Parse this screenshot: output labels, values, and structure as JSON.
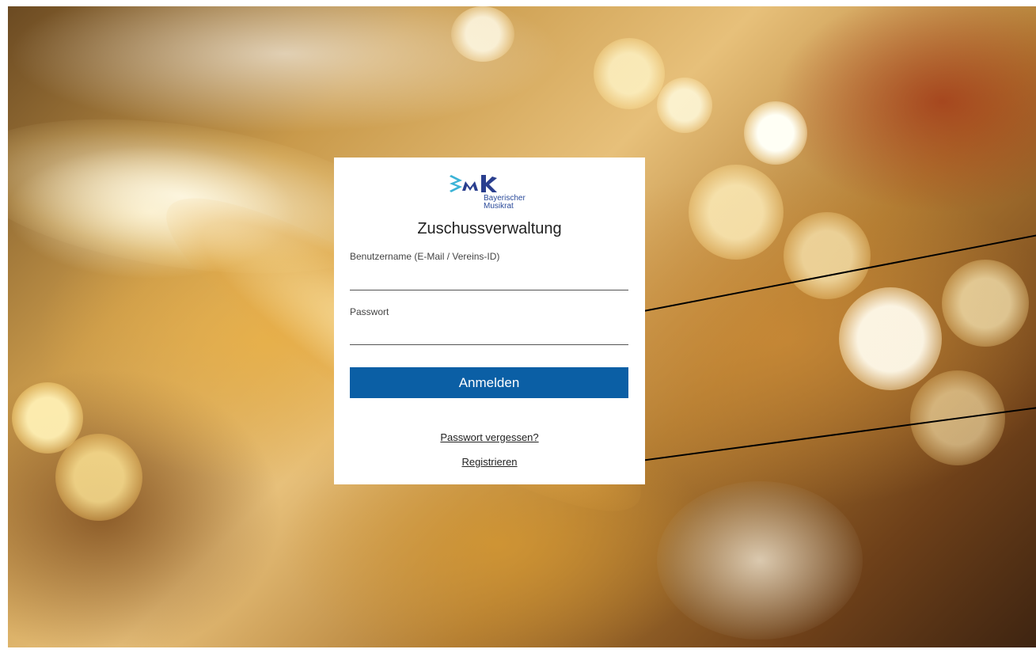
{
  "brand": {
    "logo_line1": "Bayerischer",
    "logo_line2": "Musikrat",
    "logo_icon": "bmr-logo-icon",
    "logo_color": "#2a4a9a"
  },
  "app_title": "Zuschussverwaltung",
  "form": {
    "username_label": "Benutzername (E-Mail / Vereins-ID)",
    "username_value": "",
    "password_label": "Passwort",
    "password_value": "",
    "submit_label": "Anmelden",
    "submit_color": "#0b5fa5"
  },
  "links": {
    "forgot_password": "Passwort vergessen?",
    "register": "Registrieren"
  },
  "background": {
    "image_subject": "brass-instrument-photo"
  }
}
